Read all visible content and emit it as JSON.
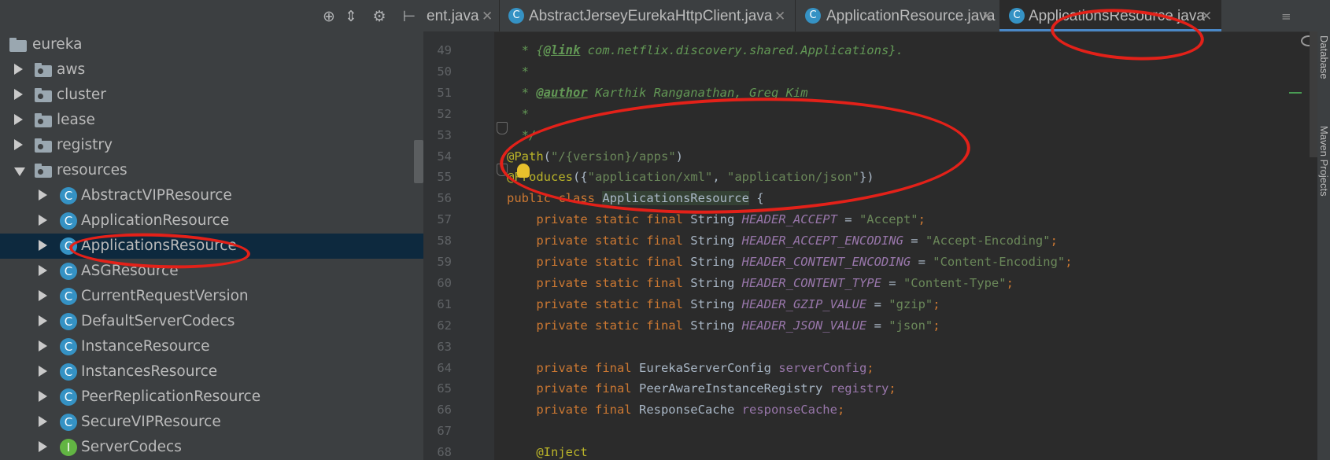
{
  "project_panel": {
    "toolbar_icons": [
      "target-icon",
      "collapse-icon",
      "gear-icon",
      "hide-panel-icon"
    ],
    "tree": [
      {
        "label": "eureka",
        "kind": "module",
        "expanded": true,
        "depth": 0
      },
      {
        "label": "aws",
        "kind": "package",
        "expanded": false,
        "depth": 1
      },
      {
        "label": "cluster",
        "kind": "package",
        "expanded": false,
        "depth": 1
      },
      {
        "label": "lease",
        "kind": "package",
        "expanded": false,
        "depth": 1
      },
      {
        "label": "registry",
        "kind": "package",
        "expanded": false,
        "depth": 1
      },
      {
        "label": "resources",
        "kind": "package",
        "expanded": true,
        "depth": 1
      },
      {
        "label": "AbstractVIPResource",
        "kind": "abstract-class",
        "depth": 2
      },
      {
        "label": "ApplicationResource",
        "kind": "class",
        "depth": 2
      },
      {
        "label": "ApplicationsResource",
        "kind": "class",
        "depth": 2,
        "selected": true
      },
      {
        "label": "ASGResource",
        "kind": "class",
        "depth": 2
      },
      {
        "label": "CurrentRequestVersion",
        "kind": "class",
        "depth": 2
      },
      {
        "label": "DefaultServerCodecs",
        "kind": "class",
        "depth": 2
      },
      {
        "label": "InstanceResource",
        "kind": "class",
        "depth": 2
      },
      {
        "label": "InstancesResource",
        "kind": "class",
        "depth": 2
      },
      {
        "label": "PeerReplicationResource",
        "kind": "class",
        "depth": 2
      },
      {
        "label": "SecureVIPResource",
        "kind": "class",
        "depth": 2
      },
      {
        "label": "ServerCodecs",
        "kind": "interface",
        "depth": 2
      }
    ]
  },
  "tabs": [
    {
      "label": "ent.java",
      "icon": "",
      "active": false
    },
    {
      "label": "AbstractJerseyEurekaHttpClient.java",
      "icon": "C",
      "active": false
    },
    {
      "label": "ApplicationResource.java",
      "icon": "C",
      "active": false
    },
    {
      "label": "ApplicationsResource.java",
      "icon": "C",
      "active": true
    }
  ],
  "tab_close": "✕",
  "tab_menu": "≡",
  "code_lines": [
    {
      "n": "49",
      "parts": [
        [
          "c-doc",
          "  * {"
        ],
        [
          "c-tag",
          "@link"
        ],
        [
          "c-doc",
          " com.netflix.discovery.shared.Applications}."
        ]
      ]
    },
    {
      "n": "50",
      "parts": [
        [
          "c-doc",
          "  *"
        ]
      ]
    },
    {
      "n": "51",
      "parts": [
        [
          "c-doc",
          "  * "
        ],
        [
          "c-tag",
          "@author"
        ],
        [
          "c-doc",
          " Karthik Ranganathan, Greg Kim"
        ]
      ]
    },
    {
      "n": "52",
      "parts": [
        [
          "c-doc",
          "  *"
        ]
      ]
    },
    {
      "n": "53",
      "parts": [
        [
          "c-doc",
          "  */"
        ]
      ]
    },
    {
      "n": "54",
      "parts": [
        [
          "c-ann",
          "@Path"
        ],
        [
          "c-plain",
          "("
        ],
        [
          "c-str",
          "\"/{version}/apps\""
        ],
        [
          "c-plain",
          ")"
        ]
      ]
    },
    {
      "n": "55",
      "parts": [
        [
          "c-ann",
          "@Produces"
        ],
        [
          "c-plain",
          "({"
        ],
        [
          "c-str",
          "\"application/xml\""
        ],
        [
          "c-plain",
          ", "
        ],
        [
          "c-str",
          "\"application/json\""
        ],
        [
          "c-plain",
          "})"
        ]
      ]
    },
    {
      "n": "56",
      "parts": [
        [
          "c-kw",
          "public class "
        ],
        [
          "hl-name",
          "ApplicationsResource"
        ],
        [
          "c-plain",
          " {"
        ]
      ]
    },
    {
      "n": "57",
      "parts": [
        [
          "c-kw",
          "    private static final "
        ],
        [
          "c-plain",
          "String "
        ],
        [
          "c-cst",
          "HEADER_ACCEPT"
        ],
        [
          "c-plain",
          " = "
        ],
        [
          "c-str",
          "\"Accept\""
        ],
        [
          "c-kw",
          ";"
        ]
      ]
    },
    {
      "n": "58",
      "parts": [
        [
          "c-kw",
          "    private static final "
        ],
        [
          "c-plain",
          "String "
        ],
        [
          "c-cst",
          "HEADER_ACCEPT_ENCODING"
        ],
        [
          "c-plain",
          " = "
        ],
        [
          "c-str",
          "\"Accept-Encoding\""
        ],
        [
          "c-kw",
          ";"
        ]
      ]
    },
    {
      "n": "59",
      "parts": [
        [
          "c-kw",
          "    private static final "
        ],
        [
          "c-plain",
          "String "
        ],
        [
          "c-cst",
          "HEADER_CONTENT_ENCODING"
        ],
        [
          "c-plain",
          " = "
        ],
        [
          "c-str",
          "\"Content-Encoding\""
        ],
        [
          "c-kw",
          ";"
        ]
      ]
    },
    {
      "n": "60",
      "parts": [
        [
          "c-kw",
          "    private static final "
        ],
        [
          "c-plain",
          "String "
        ],
        [
          "c-cst",
          "HEADER_CONTENT_TYPE"
        ],
        [
          "c-plain",
          " = "
        ],
        [
          "c-str",
          "\"Content-Type\""
        ],
        [
          "c-kw",
          ";"
        ]
      ]
    },
    {
      "n": "61",
      "parts": [
        [
          "c-kw",
          "    private static final "
        ],
        [
          "c-plain",
          "String "
        ],
        [
          "c-cst",
          "HEADER_GZIP_VALUE"
        ],
        [
          "c-plain",
          " = "
        ],
        [
          "c-str",
          "\"gzip\""
        ],
        [
          "c-kw",
          ";"
        ]
      ]
    },
    {
      "n": "62",
      "parts": [
        [
          "c-kw",
          "    private static final "
        ],
        [
          "c-plain",
          "String "
        ],
        [
          "c-cst",
          "HEADER_JSON_VALUE"
        ],
        [
          "c-plain",
          " = "
        ],
        [
          "c-str",
          "\"json\""
        ],
        [
          "c-kw",
          ";"
        ]
      ]
    },
    {
      "n": "63",
      "parts": []
    },
    {
      "n": "64",
      "parts": [
        [
          "c-kw",
          "    private final "
        ],
        [
          "c-plain",
          "EurekaServerConfig "
        ],
        [
          "c-fld",
          "serverConfig"
        ],
        [
          "c-kw",
          ";"
        ]
      ]
    },
    {
      "n": "65",
      "parts": [
        [
          "c-kw",
          "    private final "
        ],
        [
          "c-plain",
          "PeerAwareInstanceRegistry "
        ],
        [
          "c-fld",
          "registry"
        ],
        [
          "c-kw",
          ";"
        ]
      ]
    },
    {
      "n": "66",
      "parts": [
        [
          "c-kw",
          "    private final "
        ],
        [
          "c-plain",
          "ResponseCache "
        ],
        [
          "c-fld",
          "responseCache"
        ],
        [
          "c-kw",
          ";"
        ]
      ]
    },
    {
      "n": "67",
      "parts": []
    },
    {
      "n": "68",
      "parts": [
        [
          "c-ann",
          "    @Inject"
        ]
      ]
    }
  ],
  "right_strip": {
    "labels": [
      "Database",
      "Maven Projects"
    ]
  },
  "colors": {
    "annotation_circle": "#e32119",
    "selection": "#0d293e",
    "active_tab_underline": "#4a88c7"
  }
}
